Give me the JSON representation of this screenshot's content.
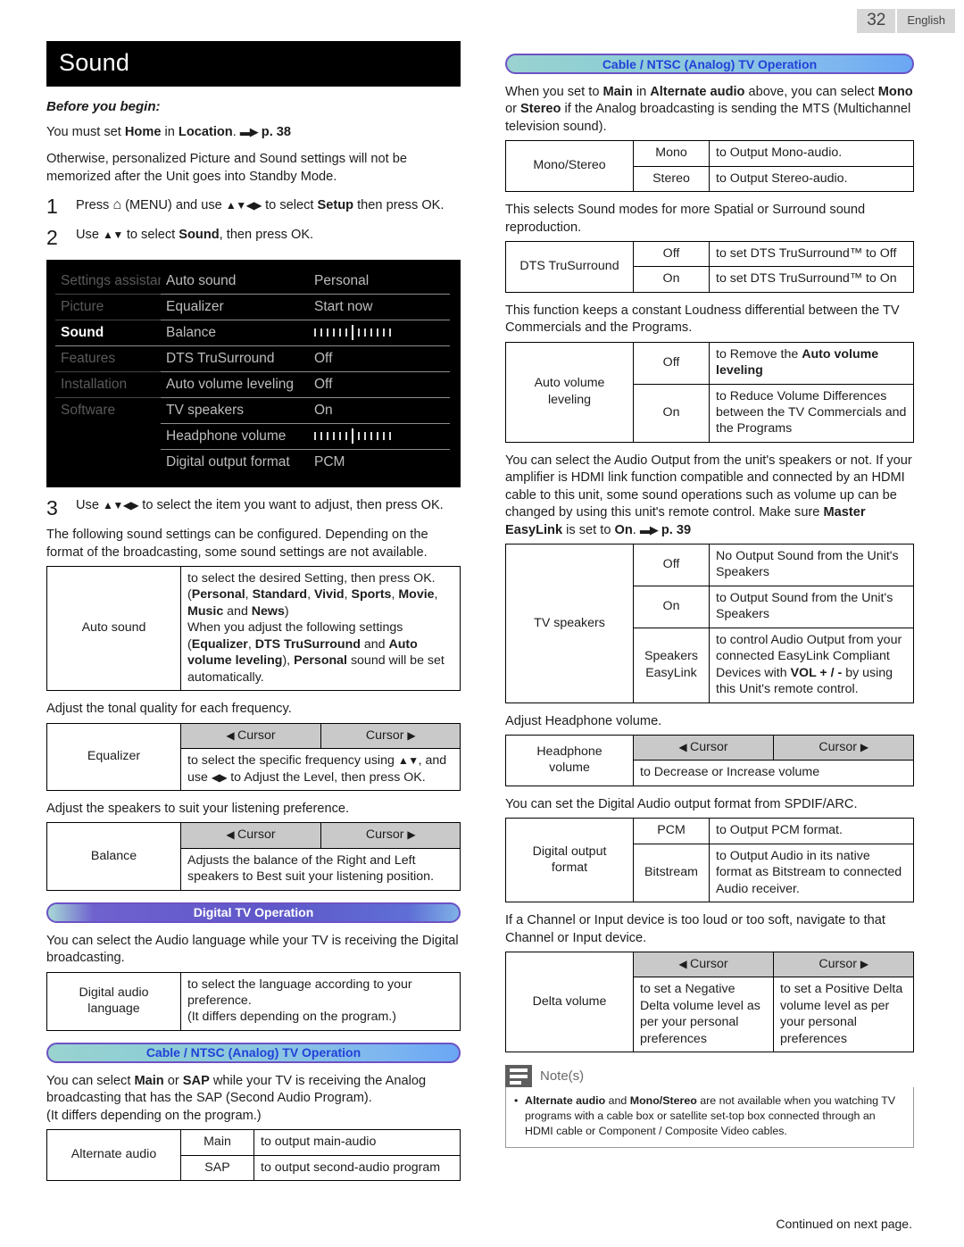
{
  "header": {
    "page_number": "32",
    "language": "English"
  },
  "footer": {
    "continued": "Continued on next page."
  },
  "left": {
    "title": "Sound",
    "before_you_begin": "Before you begin:",
    "loc_p1": "You must set Home in Location.",
    "loc_page_ref": "p. 38",
    "loc_p2": "Otherwise, personalized Picture and Sound settings will not be memorized after the Unit goes into Standby Mode.",
    "step1_num": "1",
    "step1_text_a": "Press",
    "step1_menu": "(MENU) and use",
    "step1_text_b": "to select Setup then press OK.",
    "step2_num": "2",
    "step2_text_a": "Use",
    "step2_text_b": "to select Sound, then press OK.",
    "step3_num": "3",
    "step3_text_a": "Use",
    "step3_text_b": "to select the item you want to adjust, then press OK.",
    "menu": {
      "nav": [
        "Settings assistant",
        "Picture",
        "Sound",
        "Features",
        "Installation",
        "Software"
      ],
      "selected_nav": "Sound",
      "items": [
        {
          "label": "Auto sound",
          "value": "Personal",
          "type": "text"
        },
        {
          "label": "Equalizer",
          "value": "Start now",
          "type": "text"
        },
        {
          "label": "Balance",
          "value": "",
          "type": "slider"
        },
        {
          "label": "DTS TruSurround",
          "value": "Off",
          "type": "text"
        },
        {
          "label": "Auto volume leveling",
          "value": "Off",
          "type": "text"
        },
        {
          "label": "TV speakers",
          "value": "On",
          "type": "text"
        },
        {
          "label": "Headphone volume",
          "value": "",
          "type": "slider"
        },
        {
          "label": "Digital output format",
          "value": "PCM",
          "type": "text"
        }
      ]
    },
    "intro_settings": "The following sound settings can be configured. Depending on the format of the broadcasting, some sound settings are not available.",
    "auto_sound": {
      "label": "Auto sound",
      "line1": "to select the desired Setting, then press OK.",
      "line2": "(Personal, Standard, Vivid, Sports, Movie, Music and News)",
      "line3": "When you adjust the following settings (Equalizer, DTS TruSurround and Auto volume leveling), Personal sound will be set automatically."
    },
    "equalizer": {
      "intro": "Adjust the tonal quality for each frequency.",
      "label": "Equalizer",
      "cursor_left": "Cursor",
      "cursor_right": "Cursor",
      "desc": "to select the specific frequency using ▲▼, and use ◀▶ to Adjust the Level, then press OK."
    },
    "balance": {
      "intro": "Adjust the speakers to suit your listening preference.",
      "label": "Balance",
      "cursor_left": "Cursor",
      "cursor_right": "Cursor",
      "desc": "Adjusts the balance of the Right and Left speakers to Best suit your listening position."
    },
    "banner_digital": "Digital TV Operation",
    "digital_intro": "You can select the Audio language while your TV is receiving the Digital broadcasting.",
    "digital_audio": {
      "label": "Digital audio language",
      "desc_line1": "to select the language according to your preference.",
      "desc_line2": "(It differs depending on the program.)"
    },
    "banner_cable": "Cable / NTSC (Analog) TV Operation",
    "analog_intro": "You can select Main or SAP while your TV is receiving the Analog broadcasting that has the SAP (Second Audio Program).\n(It differs depending on the program.)",
    "alternate_audio": {
      "label": "Alternate audio",
      "rows": [
        {
          "opt": "Main",
          "desc": "to output main-audio"
        },
        {
          "opt": "SAP",
          "desc": "to output second-audio program"
        }
      ]
    }
  },
  "right": {
    "banner_cable": "Cable / NTSC (Analog) TV Operation",
    "mono_intro": "When you set to Main in Alternate audio above, you can select Mono or Stereo if the Analog broadcasting is sending the MTS (Multichannel television sound).",
    "mono_stereo": {
      "label": "Mono/Stereo",
      "rows": [
        {
          "opt": "Mono",
          "desc": "to Output Mono-audio."
        },
        {
          "opt": "Stereo",
          "desc": "to Output Stereo-audio."
        }
      ]
    },
    "dts_intro": "This selects Sound modes for more Spatial or Surround sound reproduction.",
    "dts": {
      "label": "DTS TruSurround",
      "rows": [
        {
          "opt": "Off",
          "desc": "to set DTS TruSurround™ to Off"
        },
        {
          "opt": "On",
          "desc": "to set DTS TruSurround™ to On"
        }
      ]
    },
    "avl_intro": "This function keeps a constant Loudness differential between the TV Commercials and the Programs.",
    "avl": {
      "label": "Auto volume leveling",
      "rows": [
        {
          "opt": "Off",
          "desc": "to Remove the Auto volume leveling"
        },
        {
          "opt": "On",
          "desc": "to Reduce Volume Differences between the TV Commercials and the Programs"
        }
      ]
    },
    "speakers_intro": "You can select the Audio Output from the unit's speakers or not. If your amplifier is HDMI link function compatible and connected by an HDMI cable to this unit, some sound operations such as volume up can be changed by using this unit's remote control. Make sure Master EasyLink is set to On.",
    "speakers_page_ref": "p. 39",
    "tv_speakers": {
      "label": "TV speakers",
      "rows": [
        {
          "opt": "Off",
          "desc": "No Output Sound from the Unit's Speakers"
        },
        {
          "opt": "On",
          "desc": "to Output Sound from the Unit's Speakers"
        },
        {
          "opt": "Speakers EasyLink",
          "desc": "to control Audio Output from your connected EasyLink Compliant Devices with VOL + / - by using this Unit's remote control."
        }
      ]
    },
    "headphone_intro": "Adjust Headphone volume.",
    "headphone": {
      "label": "Headphone volume",
      "cursor_left": "Cursor",
      "cursor_right": "Cursor",
      "desc": "to Decrease or Increase volume"
    },
    "digital_out_intro": "You can set the Digital Audio output format from SPDIF/ARC.",
    "digital_out": {
      "label": "Digital output format",
      "rows": [
        {
          "opt": "PCM",
          "desc": "to Output PCM format."
        },
        {
          "opt": "Bitstream",
          "desc": "to Output Audio in its native format as Bitstream to connected Audio receiver."
        }
      ]
    },
    "delta_intro": "If a Channel or Input device is too loud or too soft, navigate to that Channel or Input device.",
    "delta": {
      "label": "Delta volume",
      "cursor_left": "Cursor",
      "cursor_right": "Cursor",
      "desc_left": "to set a Negative Delta volume level as per your personal preferences",
      "desc_right": "to set a Positive Delta volume level as per your personal preferences"
    },
    "notes_label": "Note(s)",
    "note_text": "Alternate audio and Mono/Stereo are not available when you watching TV programs with a cable box or satellite set-top box connected through an HDMI cable or Component / Composite Video cables."
  }
}
